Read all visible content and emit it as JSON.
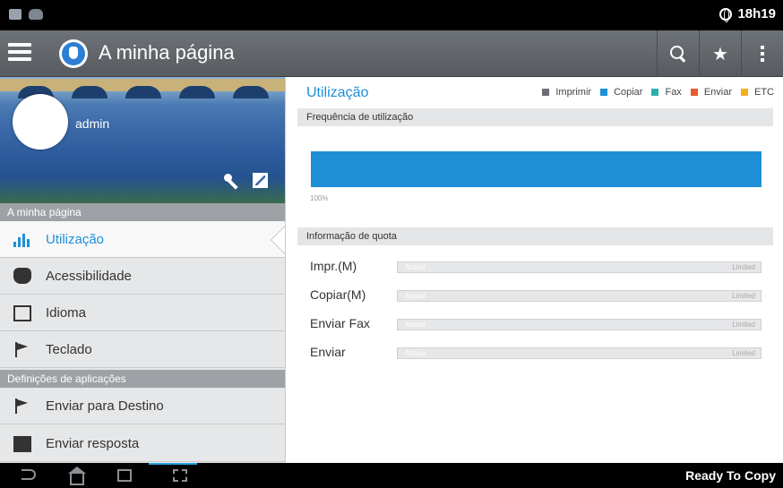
{
  "status_bar": {
    "time": "18h19"
  },
  "action_bar": {
    "title": "A minha página"
  },
  "profile": {
    "user": "admin"
  },
  "sidebar": {
    "section1": "A minha página",
    "items": [
      {
        "label": "Utilização",
        "icon": "bar-chart-icon",
        "active": true
      },
      {
        "label": "Acessibilidade",
        "icon": "hand-icon"
      },
      {
        "label": "Idioma",
        "icon": "monitor-icon"
      },
      {
        "label": "Teclado",
        "icon": "flag-icon"
      }
    ],
    "section2": "Definições de aplicações",
    "items2": [
      {
        "label": "Enviar para Destino",
        "icon": "flag-icon"
      },
      {
        "label": "Enviar resposta",
        "icon": "document-icon"
      }
    ]
  },
  "main": {
    "title": "Utilização",
    "legend": [
      {
        "label": "Imprimir",
        "color": "#6b6f74"
      },
      {
        "label": "Copiar",
        "color": "#1e8fd6"
      },
      {
        "label": "Fax",
        "color": "#2bb0b0"
      },
      {
        "label": "Enviar",
        "color": "#e8592f"
      },
      {
        "label": "ETC",
        "color": "#f2b01e"
      }
    ],
    "frequency_header": "Frequência de utilização",
    "frequency_percent": "100%",
    "quota_header": "Informação de quota",
    "quotas": [
      {
        "label": "Impr.(M)",
        "actual": "Actual",
        "limited": "Limited"
      },
      {
        "label": "Copiar(M)",
        "actual": "Actual",
        "limited": "Limited"
      },
      {
        "label": "Enviar Fax",
        "actual": "Actual",
        "limited": "Limited"
      },
      {
        "label": "Enviar",
        "actual": "Actual",
        "limited": "Limited"
      }
    ]
  },
  "nav_bar": {
    "status": "Ready To Copy"
  }
}
